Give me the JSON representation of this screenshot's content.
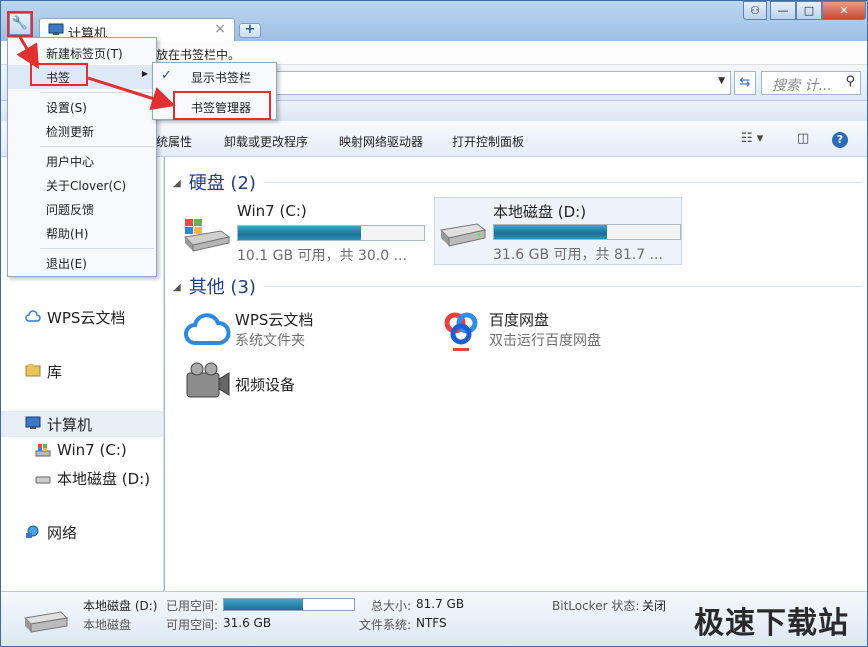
{
  "tab": {
    "title": "计算机",
    "close": "×",
    "new": "+"
  },
  "window_controls": {
    "user": "⚇",
    "min": "—",
    "max": "□",
    "close": "✕"
  },
  "notice_text": "放在书签栏中。",
  "search": {
    "placeholder": "搜索 计..."
  },
  "commands": [
    "统属性",
    "卸载或更改程序",
    "映射网络驱动器",
    "打开控制面板"
  ],
  "menu": {
    "items": [
      "新建标签页(T)",
      "书签",
      "设置(S)",
      "检测更新",
      "用户中心",
      "关于Clover(C)",
      "问题反馈",
      "帮助(H)",
      "退出(E)"
    ]
  },
  "submenu": {
    "items": [
      "显示书签栏",
      "书签管理器"
    ],
    "check": "✓"
  },
  "sidebar": {
    "items": [
      {
        "label": "WPS云文档"
      },
      {
        "label": "库"
      },
      {
        "label": "计算机"
      },
      {
        "label": "Win7 (C:)"
      },
      {
        "label": "本地磁盘 (D:)"
      },
      {
        "label": "网络"
      }
    ]
  },
  "groups": {
    "drives": {
      "label": "硬盘 (2)"
    },
    "other": {
      "label": "其他 (3)"
    }
  },
  "drives": [
    {
      "name": "Win7 (C:)",
      "space": "10.1 GB 可用，共 30.0 ...",
      "used_fraction": 0.66
    },
    {
      "name": "本地磁盘 (D:)",
      "space": "31.6 GB 可用，共 81.7 ...",
      "used_fraction": 0.61
    }
  ],
  "others": [
    {
      "name": "WPS云文档",
      "desc": "系统文件夹"
    },
    {
      "name": "百度网盘",
      "desc": "双击运行百度网盘"
    },
    {
      "name": "视频设备",
      "desc": ""
    }
  ],
  "status": {
    "drive_name": "本地磁盘 (D:)",
    "drive_type": "本地磁盘",
    "used_label": "已用空间:",
    "used_fraction": 0.61,
    "free_label": "可用空间:",
    "free_value": "31.6 GB",
    "total_label": "总大小:",
    "total_value": "81.7 GB",
    "fs_label": "文件系统:",
    "fs_value": "NTFS",
    "bitlocker_label": "BitLocker 状态:",
    "bitlocker_value": "关闭"
  },
  "watermark": "极速下载站",
  "colors": {
    "accent": "#1e3f8a",
    "highlight": "#e03030",
    "bar": "#1c6f95"
  }
}
